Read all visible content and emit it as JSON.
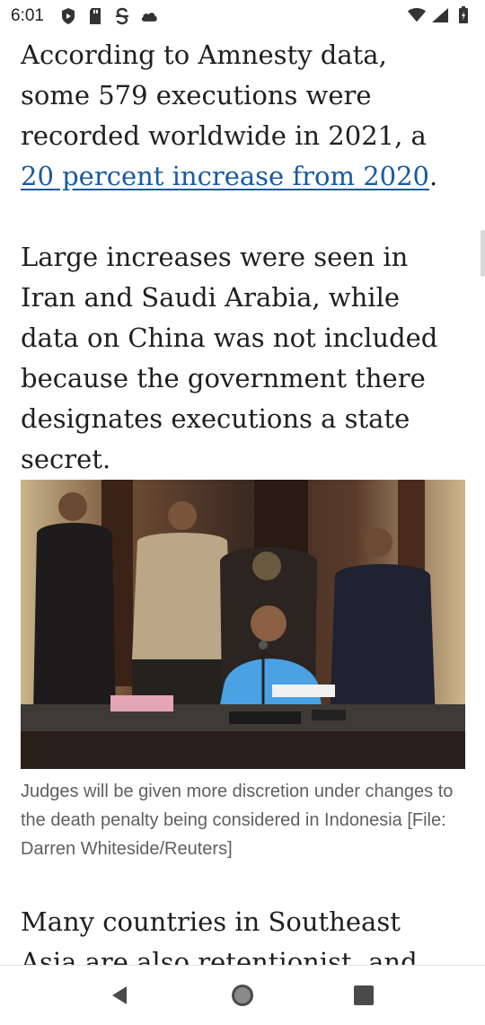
{
  "status_bar": {
    "time": "6:01"
  },
  "article": {
    "para1_text": "According to Amnesty data, some 579 executions were recorded worldwide in 2021, a ",
    "para1_link": "20 percent increase from 2020",
    "para1_end": ".",
    "para2": "Large increases were seen in Iran and Saudi Arabia, while data on China was not included because the government there designates executions a state secret.",
    "caption": "Judges will be given more discretion under changes to the death penalty being considered in Indonesia  [File: Darren Whiteside/Reuters]",
    "para3": "Many countries in Southeast Asia are also retentionist, and"
  },
  "colors": {
    "link": "#1a5aa0",
    "body_text": "#1f1f1f",
    "caption_text": "#5f5f5f"
  },
  "icons": [
    "shield-play-icon",
    "sd-card-icon",
    "s-icon",
    "cloud-icon",
    "wifi-icon",
    "cell-signal-icon",
    "battery-icon",
    "back-icon",
    "home-icon",
    "recents-icon"
  ]
}
